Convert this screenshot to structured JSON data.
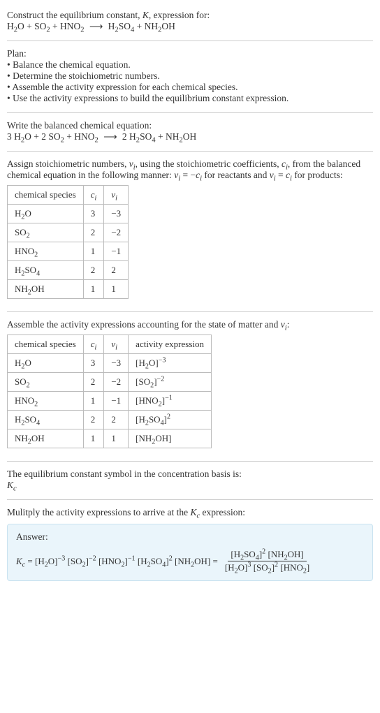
{
  "intro": {
    "line1_pre": "Construct the equilibrium constant, ",
    "line1_K": "K",
    "line1_post": ", expression for:"
  },
  "eq1": {
    "h2o": "H",
    "h2o_sub": "2",
    "h2o_o": "O",
    "plus": " + ",
    "so": "SO",
    "so_sub": "2",
    "hno": "HNO",
    "hno_sub": "2",
    "arrow": "⟶",
    "h2so4_a": "H",
    "h2so4_s1": "2",
    "h2so4_b": "SO",
    "h2so4_s2": "4",
    "nh2oh_a": "NH",
    "nh2oh_s": "2",
    "nh2oh_b": "OH"
  },
  "plan": {
    "title": "Plan:",
    "b1": "• Balance the chemical equation.",
    "b2": "• Determine the stoichiometric numbers.",
    "b3": "• Assemble the activity expression for each chemical species.",
    "b4": "• Use the activity expressions to build the equilibrium constant expression."
  },
  "balanced_label": "Write the balanced chemical equation:",
  "eq2": {
    "c1": "3 ",
    "c2": "2 ",
    "c3": "2 "
  },
  "assign": {
    "p1": "Assign stoichiometric numbers, ",
    "nu": "ν",
    "nu_sub": "i",
    "p2": ", using the stoichiometric coefficients, ",
    "c": "c",
    "c_sub": "i",
    "p3": ", from the balanced chemical equation in the following manner: ",
    "rel1a": "ν",
    "rel1b": "i",
    "rel1c": " = −",
    "rel1d": "c",
    "rel1e": "i",
    "p4": " for reactants and ",
    "rel2a": "ν",
    "rel2b": "i",
    "rel2c": " = ",
    "rel2d": "c",
    "rel2e": "i",
    "p5": " for products:"
  },
  "table1": {
    "h_species": "chemical species",
    "h_ci_a": "c",
    "h_ci_b": "i",
    "h_nu_a": "ν",
    "h_nu_b": "i",
    "rows": [
      {
        "sp_a": "H",
        "sp_s": "2",
        "sp_b": "O",
        "ci": "3",
        "nu": "−3"
      },
      {
        "sp_a": "SO",
        "sp_s": "2",
        "sp_b": "",
        "ci": "2",
        "nu": "−2"
      },
      {
        "sp_a": "HNO",
        "sp_s": "2",
        "sp_b": "",
        "ci": "1",
        "nu": "−1"
      },
      {
        "sp_a": "H",
        "sp_s": "2",
        "sp_b": "SO",
        "sp_s2": "4",
        "ci": "2",
        "nu": "2"
      },
      {
        "sp_a": "NH",
        "sp_s": "2",
        "sp_b": "OH",
        "ci": "1",
        "nu": "1"
      }
    ]
  },
  "assemble": {
    "p1": "Assemble the activity expressions accounting for the state of matter and ",
    "nu": "ν",
    "nu_sub": "i",
    "p2": ":"
  },
  "table2": {
    "h_species": "chemical species",
    "h_ci_a": "c",
    "h_ci_b": "i",
    "h_nu_a": "ν",
    "h_nu_b": "i",
    "h_act": "activity expression",
    "rows": [
      {
        "sp_a": "H",
        "sp_s": "2",
        "sp_b": "O",
        "ci": "3",
        "nu": "−3",
        "ax_a": "[H",
        "ax_s": "2",
        "ax_b": "O]",
        "ax_exp": "−3"
      },
      {
        "sp_a": "SO",
        "sp_s": "2",
        "sp_b": "",
        "ci": "2",
        "nu": "−2",
        "ax_a": "[SO",
        "ax_s": "2",
        "ax_b": "]",
        "ax_exp": "−2"
      },
      {
        "sp_a": "HNO",
        "sp_s": "2",
        "sp_b": "",
        "ci": "1",
        "nu": "−1",
        "ax_a": "[HNO",
        "ax_s": "2",
        "ax_b": "]",
        "ax_exp": "−1"
      },
      {
        "sp_a": "H",
        "sp_s": "2",
        "sp_b": "SO",
        "sp_s2": "4",
        "ci": "2",
        "nu": "2",
        "ax_a": "[H",
        "ax_s": "2",
        "ax_b": "SO",
        "ax_s2": "4",
        "ax_c": "]",
        "ax_exp": "2"
      },
      {
        "sp_a": "NH",
        "sp_s": "2",
        "sp_b": "OH",
        "ci": "1",
        "nu": "1",
        "ax_a": "[NH",
        "ax_s": "2",
        "ax_b": "OH]",
        "ax_exp": ""
      }
    ]
  },
  "symbol": {
    "line": "The equilibrium constant symbol in the concentration basis is:",
    "K": "K",
    "c": "c"
  },
  "multiply": {
    "p1": "Mulitply the activity expressions to arrive at the ",
    "K": "K",
    "c": "c",
    "p2": " expression:"
  },
  "answer": {
    "title": "Answer:",
    "K": "K",
    "c": "c",
    "eq": " = ",
    "t1_a": "[H",
    "t1_s": "2",
    "t1_b": "O]",
    "t1_e": "−3",
    "t2_a": "[SO",
    "t2_s": "2",
    "t2_b": "]",
    "t2_e": "−2",
    "t3_a": "[HNO",
    "t3_s": "2",
    "t3_b": "]",
    "t3_e": "−1",
    "t4_a": "[H",
    "t4_s": "2",
    "t4_b": "SO",
    "t4_s2": "4",
    "t4_c": "]",
    "t4_e": "2",
    "t5_a": "[NH",
    "t5_s": "2",
    "t5_b": "OH]",
    "eq2": " = ",
    "num_a": "[H",
    "num_s": "2",
    "num_b": "SO",
    "num_s2": "4",
    "num_c": "]",
    "num_e": "2",
    "num2_a": " [NH",
    "num2_s": "2",
    "num2_b": "OH]",
    "den_a": "[H",
    "den_s": "2",
    "den_b": "O]",
    "den_e": "3",
    "den2_a": " [SO",
    "den2_s": "2",
    "den2_b": "]",
    "den2_e": "2",
    "den3_a": " [HNO",
    "den3_s": "2",
    "den3_b": "]"
  }
}
